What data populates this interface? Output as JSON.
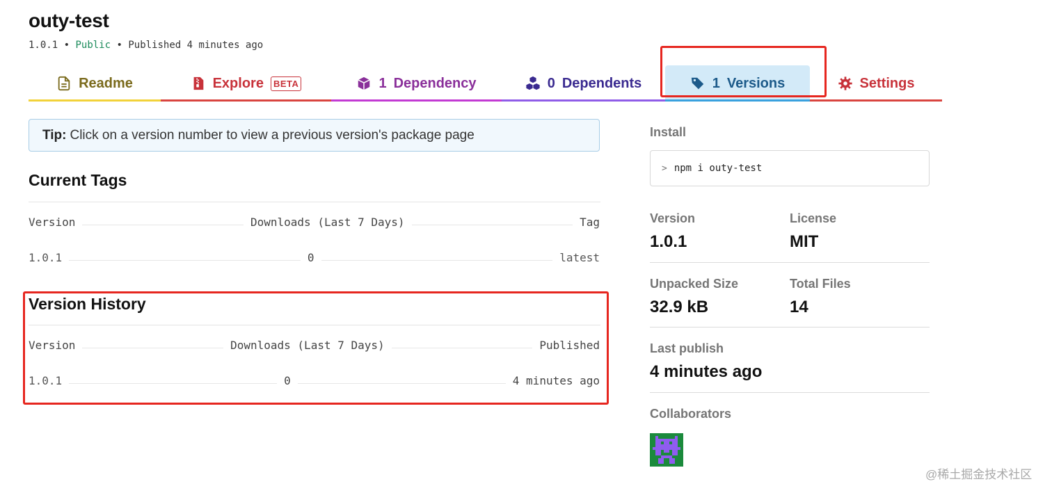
{
  "package": {
    "name": "outy-test",
    "version": "1.0.1",
    "separator": "•",
    "visibility": "Public",
    "published": "Published 4 minutes ago"
  },
  "tabs": {
    "readme": {
      "label": "Readme",
      "icon": "file-text-icon"
    },
    "explore": {
      "label": "Explore",
      "badge": "BETA",
      "icon": "zip-file-icon"
    },
    "dependency": {
      "count": "1",
      "label": "Dependency",
      "icon": "cube-icon"
    },
    "dependents": {
      "count": "0",
      "label": "Dependents",
      "icon": "cubes-icon"
    },
    "versions": {
      "count": "1",
      "label": "Versions",
      "icon": "tags-icon",
      "active": true
    },
    "settings": {
      "label": "Settings",
      "icon": "gear-icon"
    }
  },
  "tip": {
    "bold": "Tip:",
    "text": "Click on a version number to view a previous version's package page"
  },
  "current_tags": {
    "title": "Current Tags",
    "headers": {
      "version": "Version",
      "downloads": "Downloads (Last 7 Days)",
      "tag": "Tag"
    },
    "rows": [
      {
        "version": "1.0.1",
        "downloads": "0",
        "tag": "latest"
      }
    ]
  },
  "version_history": {
    "title": "Version History",
    "headers": {
      "version": "Version",
      "downloads": "Downloads (Last 7 Days)",
      "published": "Published"
    },
    "rows": [
      {
        "version": "1.0.1",
        "downloads": "0",
        "published": "4 minutes ago"
      }
    ]
  },
  "sidebar": {
    "install_label": "Install",
    "install_prompt": ">",
    "install_command": "npm i outy-test",
    "version_label": "Version",
    "version_value": "1.0.1",
    "license_label": "License",
    "license_value": "MIT",
    "unpacked_size_label": "Unpacked Size",
    "unpacked_size_value": "32.9 kB",
    "total_files_label": "Total Files",
    "total_files_value": "14",
    "last_publish_label": "Last publish",
    "last_publish_value": "4 minutes ago",
    "collaborators_label": "Collaborators"
  },
  "watermark": "@稀土掘金技术社区",
  "colors": {
    "readme": "#f2d23a",
    "explore": "#d9443f",
    "dependency": "#c23ad3",
    "dependents": "#8f5ce8",
    "versions": "#3aa1de",
    "settings": "#d9443f",
    "annotation_box": "#e6261f",
    "public": "#1a8a5a"
  }
}
